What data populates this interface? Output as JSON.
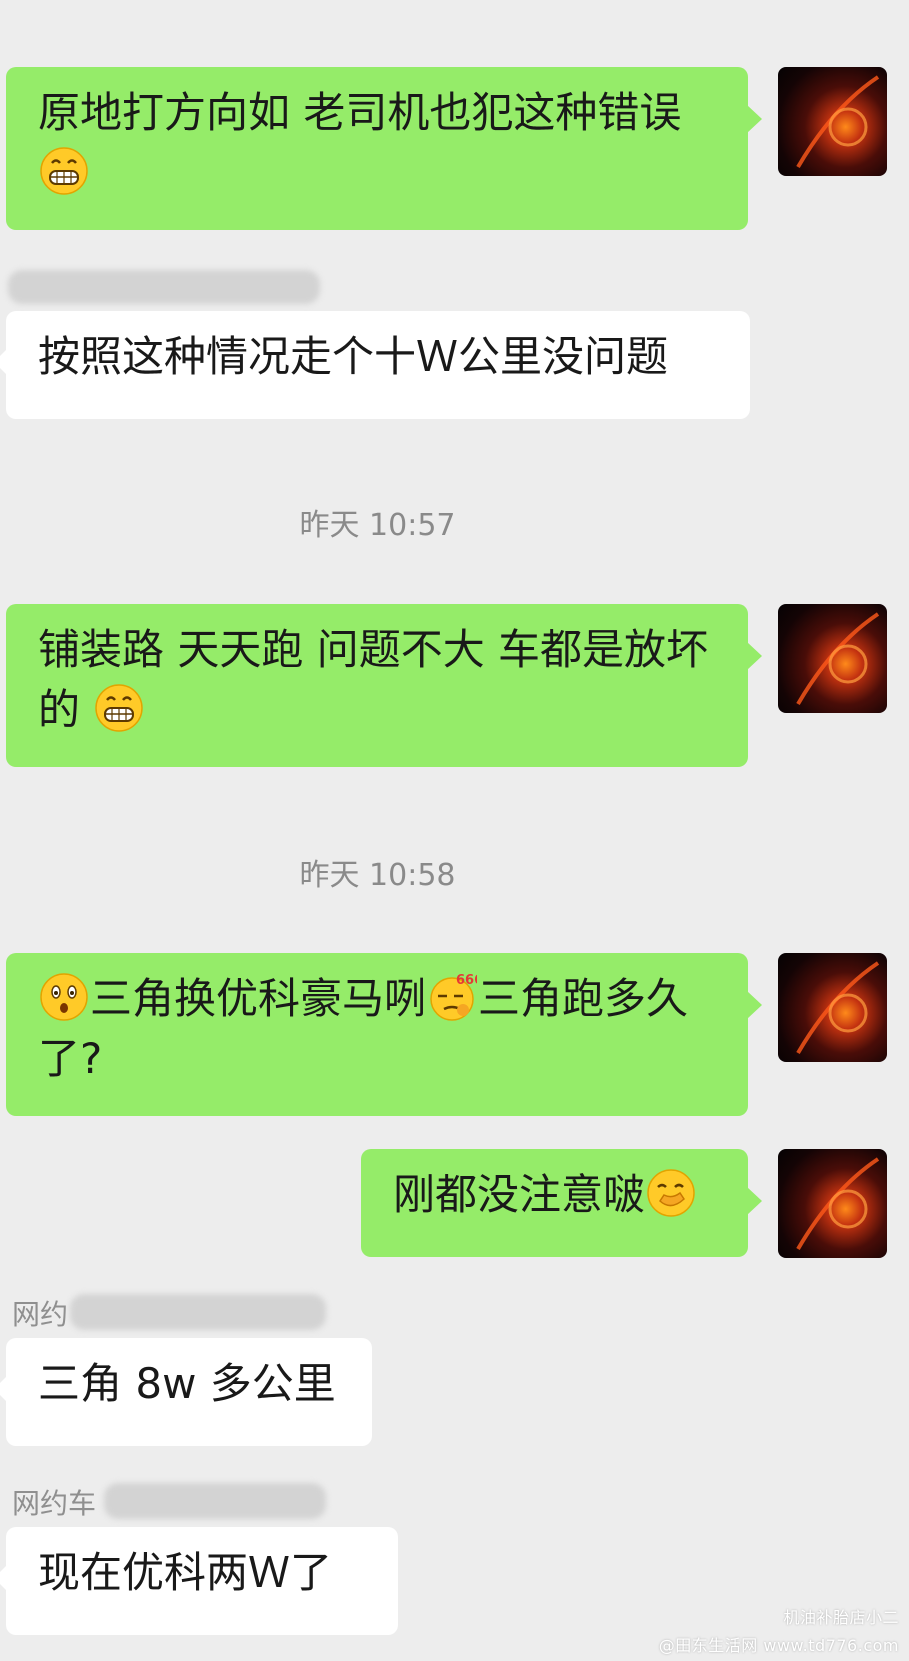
{
  "messages": {
    "m1_text": "原地打方向如  老司机也犯这种错误",
    "m2_text": "按照这种情况走个十Ｗ公里没问题",
    "m3_text": "铺装路 天天跑  问题不大  车都是放坏的",
    "m4_text_a": "三角换优科豪马咧",
    "m4_text_b": "三角跑多久了?",
    "m5_text": "刚都没注意啵",
    "m6_text": "三角 8w 多公里",
    "m7_text": "现在优科两Ｗ了"
  },
  "timestamps": {
    "t1": "昨天 10:57",
    "t2": "昨天 10:58"
  },
  "senders": {
    "s2": "网约",
    "s3": "网约车"
  },
  "emoji": {
    "grin": "grinning-emoji",
    "surprised": "surprised-emoji",
    "666": "666-smirk-emoji",
    "thinking": "covering-mouth-emoji"
  },
  "watermark": {
    "line1": "机油补胎店小二",
    "line2": "@田东生活网 www.td776.com"
  },
  "colors": {
    "outgoing_bubble": "#95ec69",
    "incoming_bubble": "#ffffff",
    "background": "#ededed"
  }
}
